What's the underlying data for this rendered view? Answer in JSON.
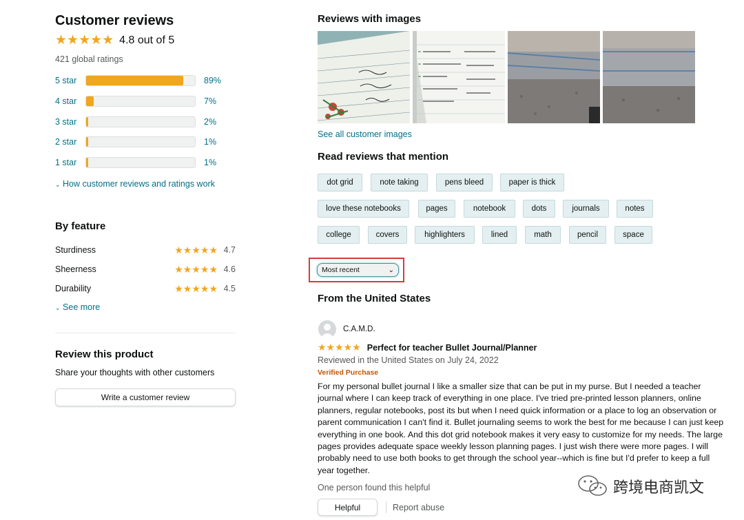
{
  "summary": {
    "title": "Customer reviews",
    "rating_text": "4.8 out of 5",
    "rating_value": 4.8,
    "global_ratings": "421 global ratings",
    "histogram": [
      {
        "label": "5 star",
        "pct": "89%",
        "fraction": 0.89
      },
      {
        "label": "4 star",
        "pct": "7%",
        "fraction": 0.07
      },
      {
        "label": "3 star",
        "pct": "2%",
        "fraction": 0.02
      },
      {
        "label": "2 star",
        "pct": "1%",
        "fraction": 0.01
      },
      {
        "label": "1 star",
        "pct": "1%",
        "fraction": 0.01
      }
    ],
    "how_link": "How customer reviews and ratings work"
  },
  "by_feature": {
    "title": "By feature",
    "items": [
      {
        "name": "Sturdiness",
        "value": "4.7"
      },
      {
        "name": "Sheerness",
        "value": "4.6"
      },
      {
        "name": "Durability",
        "value": "4.5"
      }
    ],
    "see_more": "See more"
  },
  "review_product": {
    "title": "Review this product",
    "subtitle": "Share your thoughts with other customers",
    "button": "Write a customer review"
  },
  "images": {
    "title": "Reviews with images",
    "see_all": "See all customer images"
  },
  "mentions": {
    "title": "Read reviews that mention",
    "chips": [
      [
        "dot grid",
        "note taking",
        "pens bleed",
        "paper is thick"
      ],
      [
        "love these notebooks",
        "pages",
        "notebook",
        "dots",
        "journals",
        "notes"
      ],
      [
        "college",
        "covers",
        "highlighters",
        "lined",
        "math",
        "pencil",
        "space"
      ]
    ]
  },
  "sort": {
    "selected": "Most recent"
  },
  "from_title": "From the United States",
  "review": {
    "author": "C.A.M.D.",
    "rating": 5,
    "headline": "Perfect for teacher Bullet Journal/Planner",
    "meta": "Reviewed in the United States on July 24, 2022",
    "verified": "Verified Purchase",
    "body": "For my personal bullet journal I like a smaller size that can be put in my purse. But I needed a teacher journal where I can keep track of everything in one place. I've tried pre-printed lesson planners, online planners, regular notebooks, post its but when I need quick information or a place to log an observation or parent communication I can't find it. Bullet journaling seems to work the best for me because I can just keep everything in one book. And this dot grid notebook makes it very easy to customize for my needs. The large pages provides adequate space weekly lesson planning pages. I just wish there were more pages. I will probably need to use both books to get through the school year--which is fine but I'd prefer to keep a full year together.",
    "helpful_text": "One person found this helpful",
    "helpful_button": "Helpful",
    "report": "Report abuse"
  },
  "watermark": "跨境电商凯文",
  "colors": {
    "star": "#f0a61f",
    "link": "#007185",
    "chip_bg": "#e3eff0",
    "highlight": "#d13c3c"
  }
}
